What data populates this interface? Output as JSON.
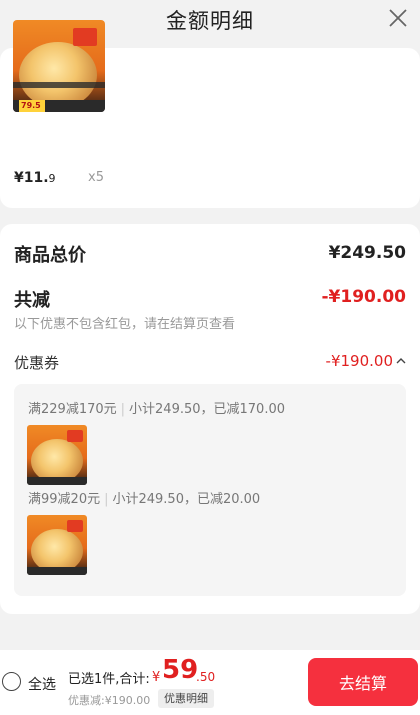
{
  "header": {
    "title": "金额明细"
  },
  "item": {
    "price_int": "¥11.",
    "price_dec": "9",
    "quantity": "x5",
    "image_tag": "79.5"
  },
  "summary": {
    "total_label": "商品总价",
    "total_value": "¥249.50",
    "reduce_label": "共减",
    "reduce_value": "-¥190.00",
    "reduce_note": "以下优惠不包含红包，请在结算页查看",
    "coupon_label": "优惠券",
    "coupon_value": "-¥190.00"
  },
  "deals": [
    {
      "rule": "满229减170元",
      "detail": "小计249.50，已减170.00"
    },
    {
      "rule": "满99减20元",
      "detail": "小计249.50，已减20.00"
    }
  ],
  "footer": {
    "select_all": "全选",
    "selected_text": "已选1件,合计:",
    "currency": "¥",
    "total_int": "59",
    "total_dec": ".50",
    "discount_text": "优惠减:¥190.00",
    "detail_button": "优惠明细",
    "checkout_button": "去结算"
  },
  "colors": {
    "accent": "#e02020",
    "checkout": "#f5303e"
  }
}
